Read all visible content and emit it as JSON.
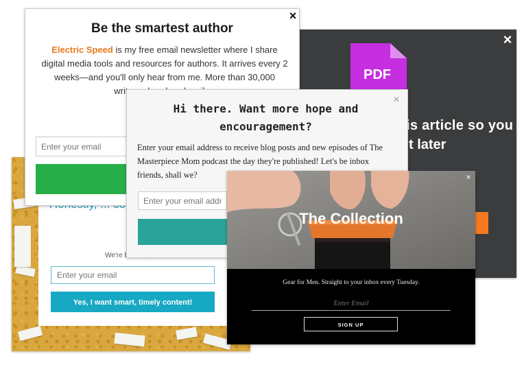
{
  "popup_smartest_author": {
    "title": "Be the smartest author",
    "close_icon": "×",
    "body_brand": "Electric Speed",
    "body_text": " is my free email newsletter where I share digital media tools and resources for authors. It arrives every 2 weeks—and you'll only hear from me. More than 30,000 writers already subscribe.",
    "email_placeholder": "Enter your email",
    "button_color": "#27ae49"
  },
  "popup_pdf": {
    "close_icon": "×",
    "icon_name": "pdf-file-icon",
    "icon_label": "PDF",
    "icon_color": "#c52fe0",
    "text_line1": "is article so you",
    "text_line2": "t later",
    "button_color": "#f47a20"
  },
  "popup_hope": {
    "close_icon": "×",
    "title": "Hi there. Want more hope and encouragement?",
    "body": "Enter your email address to receive blog posts and new episodes of The Masterpiece Mom podcast the day they're published! Let's be inbox friends, shall we?",
    "email_placeholder": "Enter your email address",
    "button_color": "#2aa398"
  },
  "popup_content_marketing": {
    "headline": "Honestly, ... content mark... out...",
    "subtext": "We're biased, but...",
    "email_placeholder": "Enter your email",
    "button_label": "Yes, I want smart, timely content!",
    "accent_color": "#17a8c4"
  },
  "popup_collection": {
    "close_icon": "×",
    "title": "The Collection",
    "subtitle": "Gear for Men. Straight to your inbox every Tuesday.",
    "email_placeholder": "Enter Email",
    "button_label": "SIGN UP"
  }
}
